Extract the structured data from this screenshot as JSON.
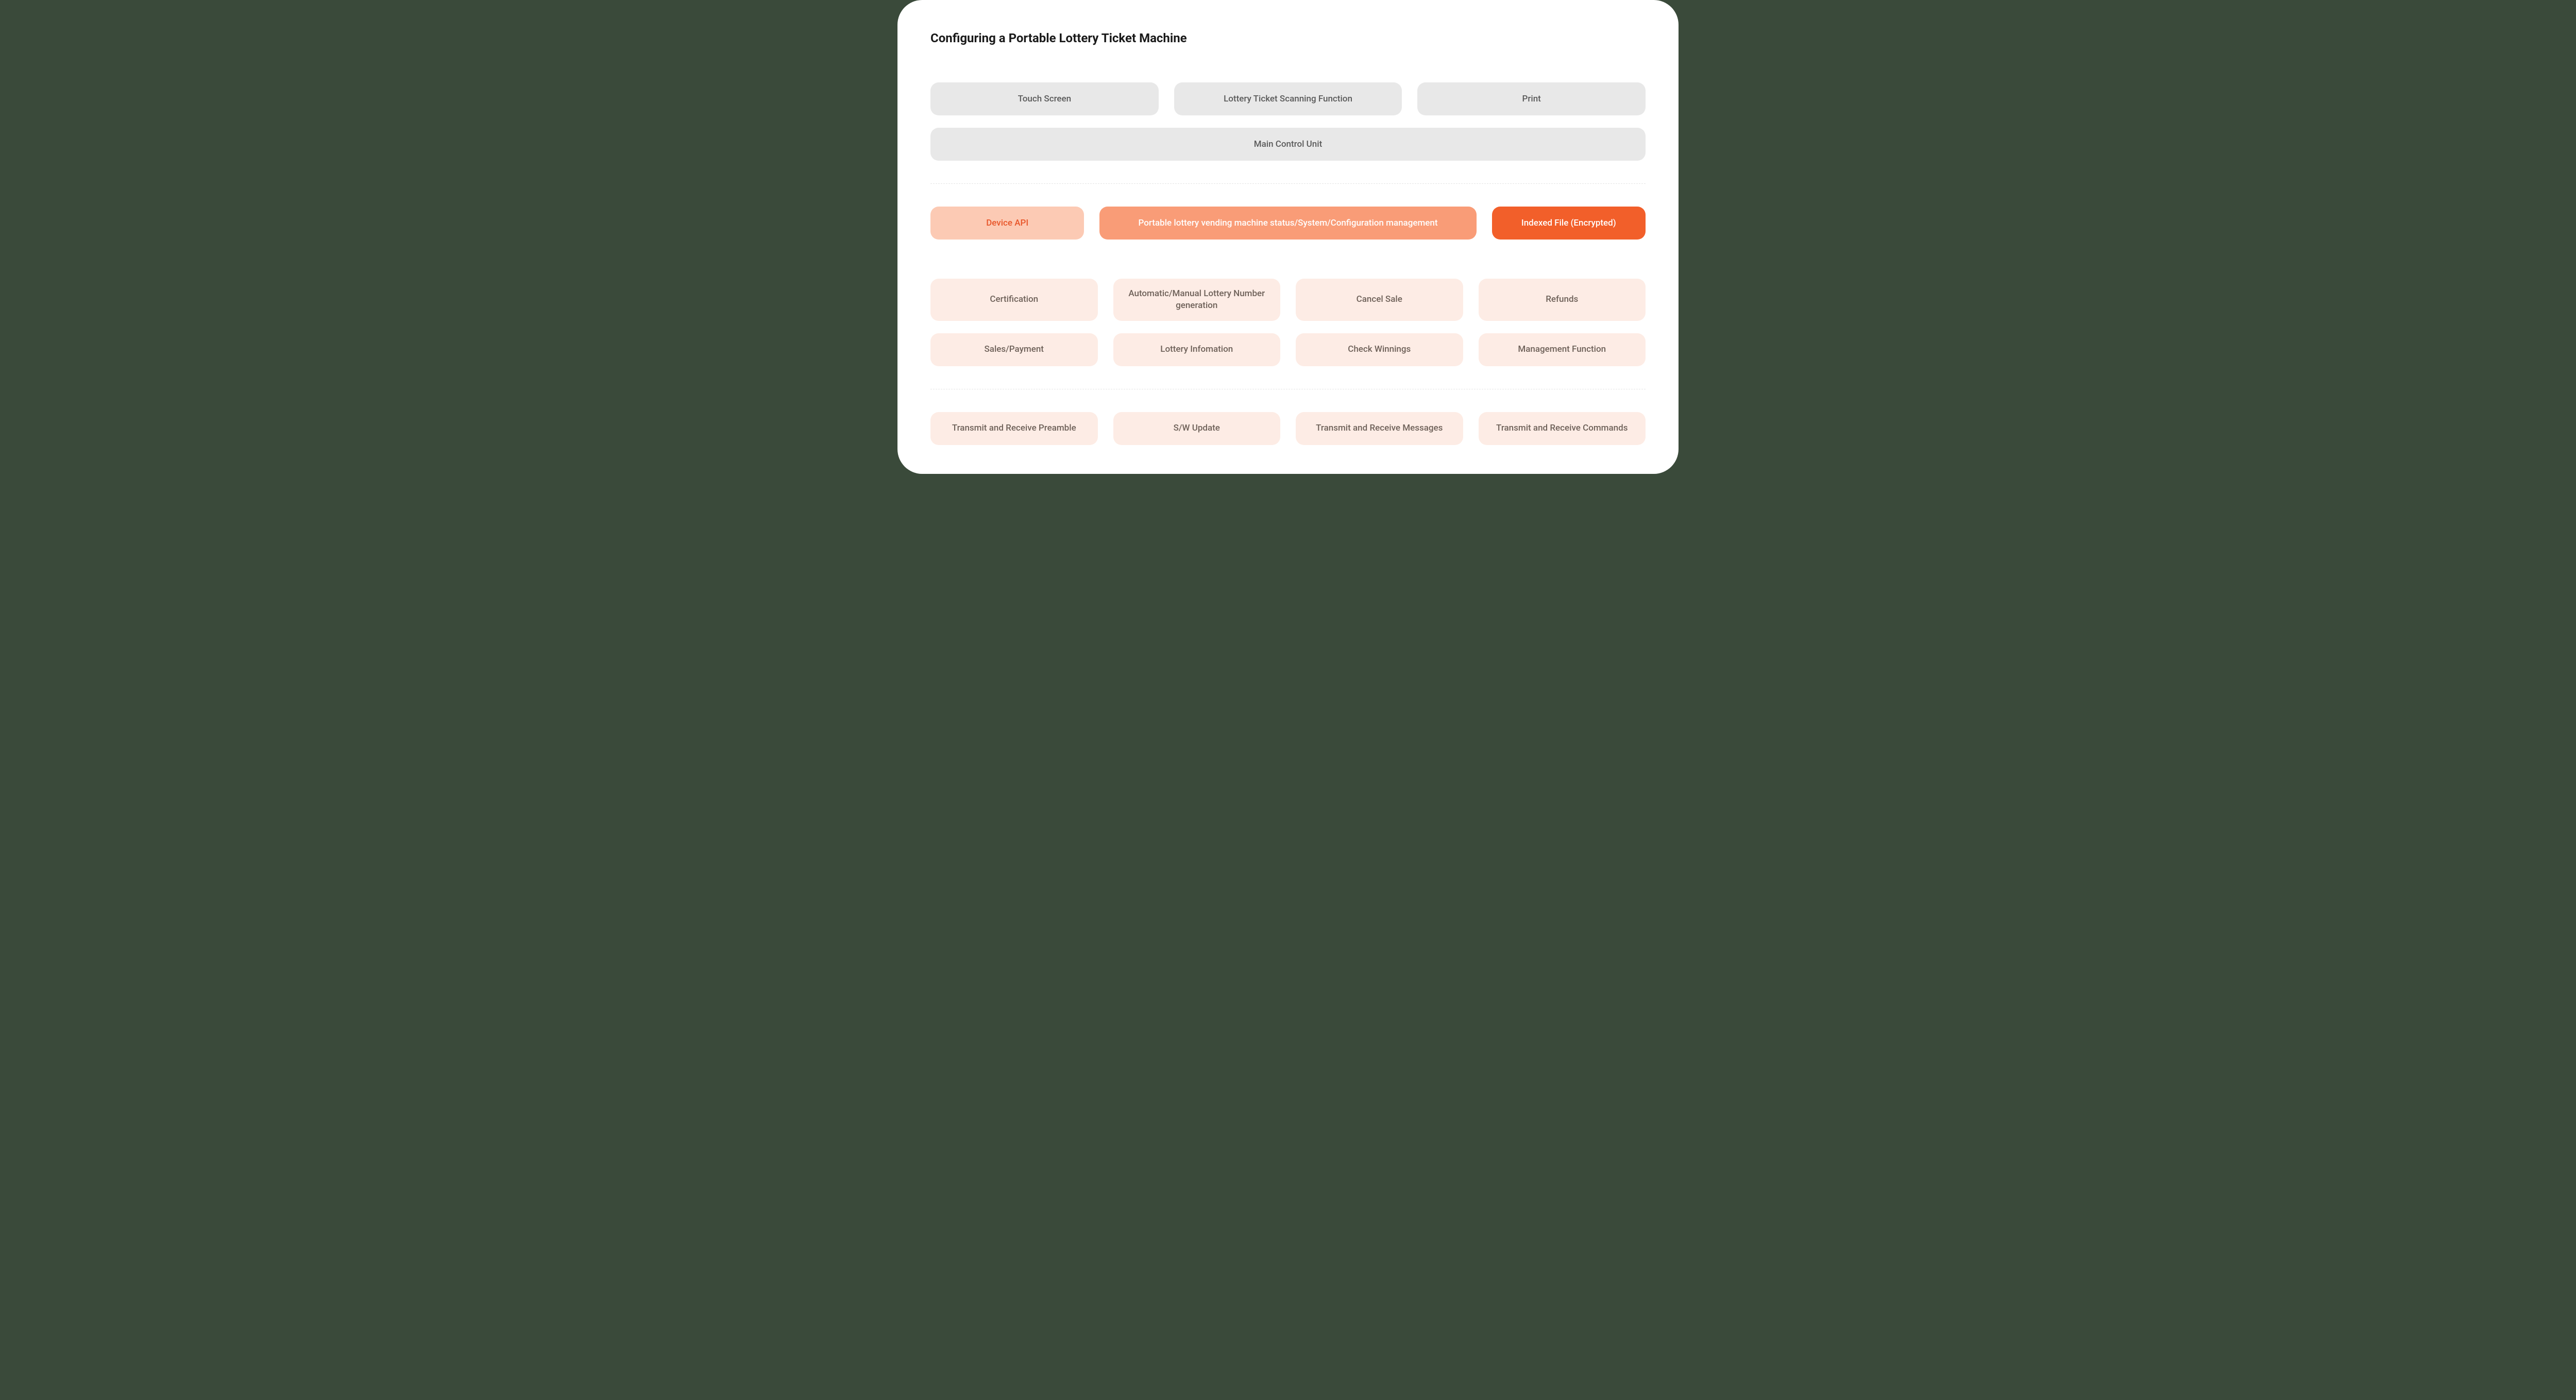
{
  "title": "Configuring a Portable Lottery Ticket Machine",
  "hardware": {
    "items": [
      "Touch Screen",
      "Lottery Ticket Scanning Function",
      "Print"
    ],
    "main_unit": "Main Control Unit"
  },
  "middleware": {
    "device_api": "Device API",
    "status_mgmt": "Portable lottery vending machine status/System/Configuration management",
    "indexed_file": "Indexed File (Encrypted)"
  },
  "functions_row1": [
    "Certification",
    "Automatic/Manual Lottery Number generation",
    "Cancel Sale",
    "Refunds"
  ],
  "functions_row2": [
    "Sales/Payment",
    "Lottery Infomation",
    "Check Winnings",
    "Management Function"
  ],
  "comm_row": [
    "Transmit and Receive Preamble",
    "S/W Update",
    "Transmit and Receive Messages",
    "Transmit and Receive Commands"
  ]
}
